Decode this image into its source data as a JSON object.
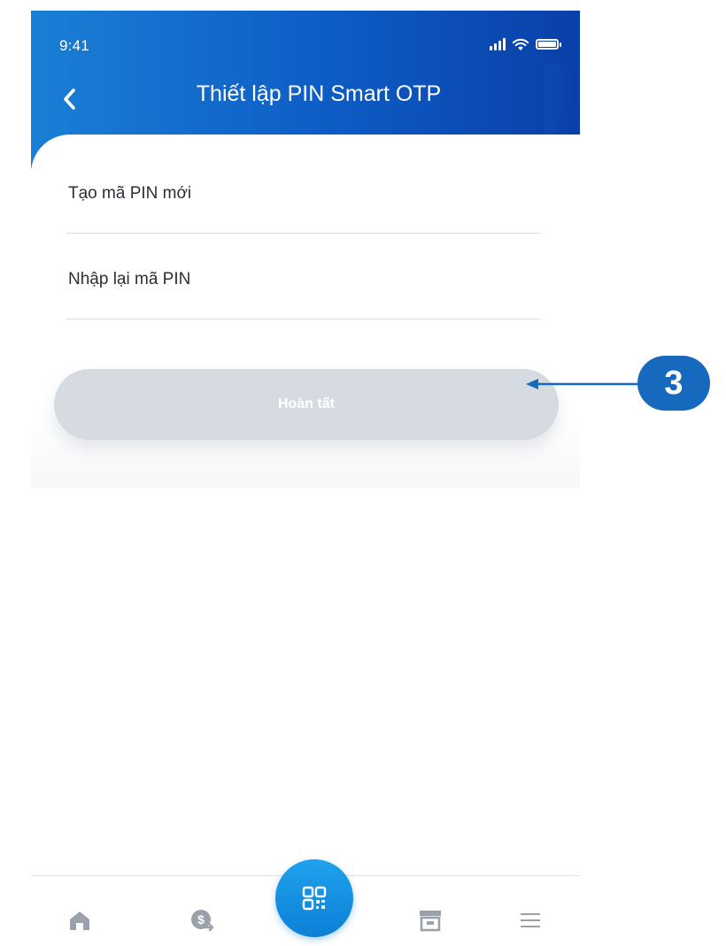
{
  "status_bar": {
    "time": "9:41",
    "icons": [
      "signal-icon",
      "wifi-icon",
      "battery-icon"
    ]
  },
  "header": {
    "back_icon": "chevron-left-icon",
    "title": "Thiết lập PIN Smart OTP",
    "gradient_colors": [
      "#1a7fd6",
      "#0a3fa8"
    ]
  },
  "form": {
    "new_pin_label": "Tạo mã PIN mới",
    "confirm_pin_label": "Nhập lại mã PIN"
  },
  "actions": {
    "done_label": "Hoàn tất",
    "done_button_color": "#d6dbe2"
  },
  "bottom_nav": {
    "items": [
      {
        "icon": "home-icon"
      },
      {
        "icon": "money-transfer-icon"
      },
      {
        "icon": "qr-code-icon"
      },
      {
        "icon": "store-icon"
      },
      {
        "icon": "menu-icon"
      }
    ],
    "qr_color": "#1693e4"
  },
  "annotation": {
    "step_number": "3",
    "color": "#1769bd"
  }
}
